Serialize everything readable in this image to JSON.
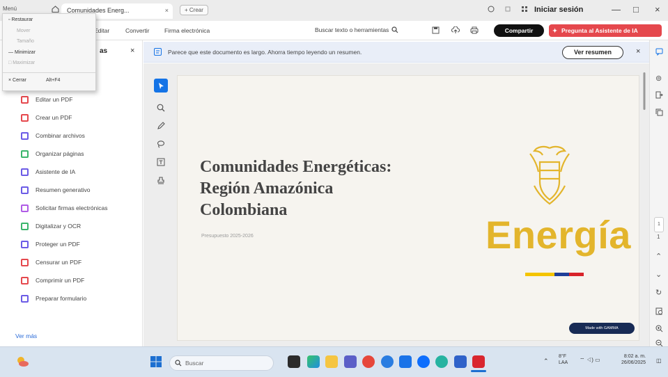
{
  "titlebar": {
    "menu_label": "Menú",
    "tab_title": "Comunidades Energ...",
    "tab_close": "×",
    "new_tab_label": "+ Crear",
    "sign_in": "Iniciar sesión",
    "minimize": "—",
    "maximize": "□",
    "close": "×"
  },
  "context_menu": {
    "items": [
      {
        "label": "Restaurar",
        "disabled": false
      },
      {
        "label": "Mover",
        "disabled": true
      },
      {
        "label": "Tamaño",
        "disabled": true
      },
      {
        "label": "Minimizar",
        "disabled": false
      },
      {
        "label": "Maximizar",
        "disabled": true
      },
      {
        "label": "Cerrar",
        "shortcut": "Alt+F4",
        "disabled": false
      }
    ]
  },
  "toolbar": {
    "menu": [
      "Editar",
      "Convertir",
      "Firma electrónica"
    ],
    "search_tools": "Buscar texto o herramientas",
    "share": "Compartir",
    "ai_assistant": "Pregunta al Asistente de IA"
  },
  "left_panel": {
    "title": "as",
    "close": "×",
    "tools": [
      {
        "label": "Editar un PDF",
        "color": "#e5484d"
      },
      {
        "label": "Crear un PDF",
        "color": "#e5484d"
      },
      {
        "label": "Combinar archivos",
        "color": "#6b5be6"
      },
      {
        "label": "Organizar páginas",
        "color": "#3bb56c"
      },
      {
        "label": "Asistente de IA",
        "color": "#6b5be6"
      },
      {
        "label": "Resumen generativo",
        "color": "#6b5be6"
      },
      {
        "label": "Solicitar firmas electrónicas",
        "color": "#b05be6"
      },
      {
        "label": "Digitalizar y OCR",
        "color": "#3bb56c"
      },
      {
        "label": "Proteger un PDF",
        "color": "#6b5be6"
      },
      {
        "label": "Censurar un PDF",
        "color": "#e5484d"
      },
      {
        "label": "Comprimir un PDF",
        "color": "#e5484d"
      },
      {
        "label": "Preparar formulario",
        "color": "#6b5be6"
      }
    ],
    "see_more": "Ver más"
  },
  "notice": {
    "text": "Parece que este documento es largo. Ahorra tiempo leyendo un resumen.",
    "button": "Ver resumen",
    "close": "×"
  },
  "document": {
    "title_lines": [
      "Comunidades Energéticas:",
      "Región Amazónica",
      "Colombiana"
    ],
    "subtitle": "Presupuesto 2025-2026",
    "brand_word": "Energía",
    "badge": "Made with GAMMA",
    "flag_colors": [
      "#f4c400",
      "#f4c400",
      "#1f3f99",
      "#d8232a"
    ]
  },
  "taskbar": {
    "search_placeholder": "Buscar",
    "weather_temp": "8°F",
    "weather_desc": "LAA",
    "time": "8:02 a. m.",
    "date": "26/06/2025"
  },
  "colors": {
    "accent_blue": "#1473e6",
    "ai_red": "#e5484d",
    "energia_gold": "#e3b52c"
  }
}
